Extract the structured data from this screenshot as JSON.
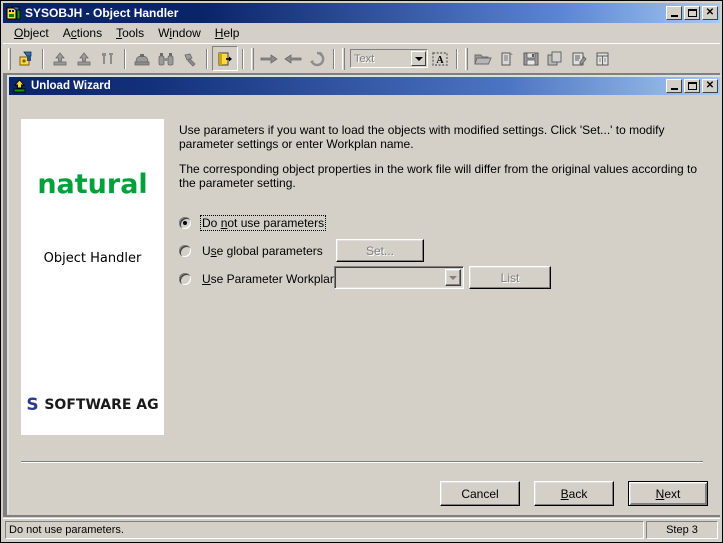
{
  "window": {
    "title": "SYSOBJH - Object Handler",
    "icon": "app-icon",
    "controls": {
      "minimize": "_",
      "maximize": "□",
      "close": "✕"
    }
  },
  "menubar": {
    "items": [
      {
        "name": "object",
        "pre": "",
        "mn": "O",
        "post": "bject"
      },
      {
        "name": "actions",
        "pre": "A",
        "mn": "c",
        "post": "tions"
      },
      {
        "name": "tools",
        "pre": "",
        "mn": "T",
        "post": "ools"
      },
      {
        "name": "window",
        "pre": "W",
        "mn": "i",
        "post": "ndow"
      },
      {
        "name": "help",
        "pre": "",
        "mn": "H",
        "post": "elp"
      }
    ]
  },
  "toolbar": {
    "combo_value": "Text",
    "buttons": [
      "load-icon",
      "unload-icon",
      "unload-down-icon",
      "tools-icon",
      "find-objects-icon",
      "binoculars-icon",
      "hammer-icon",
      "exit-icon",
      "arrow-right-icon",
      "arrow-left-icon",
      "refresh-icon",
      "font-icon",
      "open-folder-icon",
      "new-document-icon",
      "save-icon",
      "copy-icon",
      "report-icon",
      "grid-icon"
    ]
  },
  "wizard": {
    "title": "Unload Wizard",
    "icon": "unload-wizard-icon",
    "controls": {
      "minimize": "_",
      "maximize": "□",
      "close": "✕"
    },
    "logo": {
      "product": "natural",
      "subtitle": "Object Handler",
      "vendor": "SOFTWARE AG",
      "vendor_mark": "S",
      "product_color": "#00a13a",
      "vendor_color": "#2a3990"
    },
    "paragraphs": [
      "Use parameters if you want to load the objects with modified settings. Click 'Set...' to modify parameter settings or enter Workplan name.",
      "The corresponding object properties in the work file will differ from the original values according to the parameter setting."
    ],
    "options": [
      {
        "id": "do-not-use-parameters",
        "pre": "Do ",
        "mn": "n",
        "post": "ot use parameters",
        "selected": true,
        "focused": true
      },
      {
        "id": "use-global-parameters",
        "pre": "U",
        "mn": "s",
        "post": "e global parameters",
        "selected": false,
        "focused": false,
        "button": {
          "label": "Set...",
          "disabled": true
        }
      },
      {
        "id": "use-parameter-workplan",
        "pre": "",
        "mn": "U",
        "post": "se Parameter Workplan",
        "selected": false,
        "focused": false,
        "combo": {
          "value": "",
          "disabled": true
        },
        "button": {
          "label": "List",
          "disabled": true
        }
      }
    ],
    "footer": [
      {
        "id": "cancel",
        "pre": "Cancel",
        "mn": "",
        "post": "",
        "default": false
      },
      {
        "id": "back",
        "pre": "",
        "mn": "B",
        "post": "ack",
        "default": false
      },
      {
        "id": "next",
        "pre": "",
        "mn": "N",
        "post": "ext",
        "default": true
      }
    ]
  },
  "statusbar": {
    "message": "Do not use parameters.",
    "step": "Step 3"
  }
}
